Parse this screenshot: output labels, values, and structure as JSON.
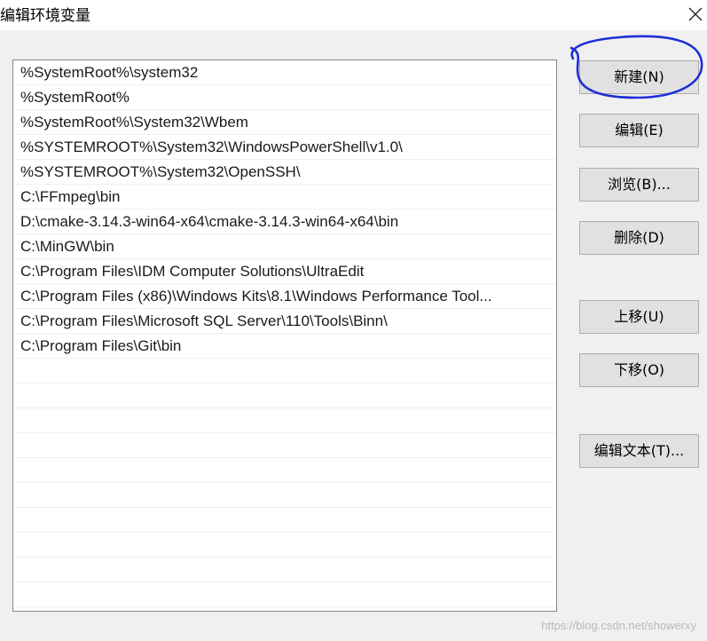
{
  "window": {
    "title": "编辑环境变量"
  },
  "path_entries": [
    "%SystemRoot%\\system32",
    "%SystemRoot%",
    "%SystemRoot%\\System32\\Wbem",
    "%SYSTEMROOT%\\System32\\WindowsPowerShell\\v1.0\\",
    "%SYSTEMROOT%\\System32\\OpenSSH\\",
    "C:\\FFmpeg\\bin",
    "D:\\cmake-3.14.3-win64-x64\\cmake-3.14.3-win64-x64\\bin",
    "C:\\MinGW\\bin",
    "C:\\Program Files\\IDM Computer Solutions\\UltraEdit",
    "C:\\Program Files (x86)\\Windows Kits\\8.1\\Windows Performance Tool...",
    "C:\\Program Files\\Microsoft SQL Server\\110\\Tools\\Binn\\",
    "C:\\Program Files\\Git\\bin"
  ],
  "buttons": {
    "new": "新建(N)",
    "edit": "编辑(E)",
    "browse": "浏览(B)...",
    "delete": "删除(D)",
    "move_up": "上移(U)",
    "move_down": "下移(O)",
    "edit_text": "编辑文本(T)..."
  },
  "annotation": {
    "color": "#1f2fd6"
  },
  "watermark": "https://blog.csdn.net/showerxy"
}
